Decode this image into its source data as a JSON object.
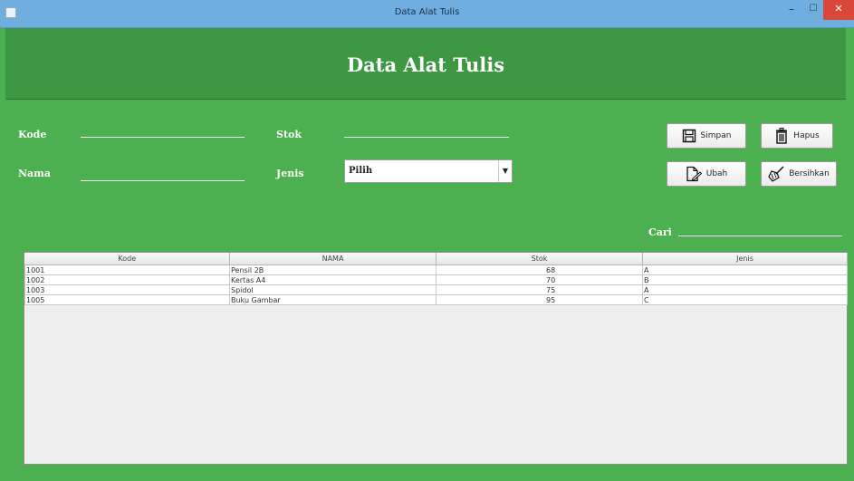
{
  "window": {
    "title": "Data Alat Tulis",
    "minimize_glyph": "–",
    "maximize_glyph": "☐",
    "close_glyph": "✕"
  },
  "header": {
    "title": "Data Alat Tulis"
  },
  "form": {
    "kode_label": "Kode",
    "kode_value": "",
    "stok_label": "Stok",
    "stok_value": "",
    "nama_label": "Nama",
    "nama_value": "",
    "jenis_label": "Jenis",
    "jenis_selected": "Pilih",
    "cari_label": "Cari",
    "cari_value": ""
  },
  "buttons": {
    "simpan": "Simpan",
    "hapus": "Hapus",
    "ubah": "Ubah",
    "bersihkan": "Bersihkan"
  },
  "icons": {
    "simpan": "save-icon",
    "hapus": "trash-icon",
    "ubah": "edit-document-icon",
    "bersihkan": "broom-icon"
  },
  "table": {
    "columns": [
      "Kode",
      "NAMA",
      "Stok",
      "Jenis"
    ],
    "rows": [
      [
        "1001",
        "Pensil 2B",
        "68",
        "A"
      ],
      [
        "1002",
        "Kertas A4",
        "70",
        "B"
      ],
      [
        "1003",
        "Spidol",
        "75",
        "A"
      ],
      [
        "1005",
        "Buku Gambar",
        "95",
        "C"
      ]
    ]
  },
  "colors": {
    "background": "#4caf50",
    "header": "#3e9742",
    "titlebar": "#6faede",
    "close": "#d9483b"
  }
}
